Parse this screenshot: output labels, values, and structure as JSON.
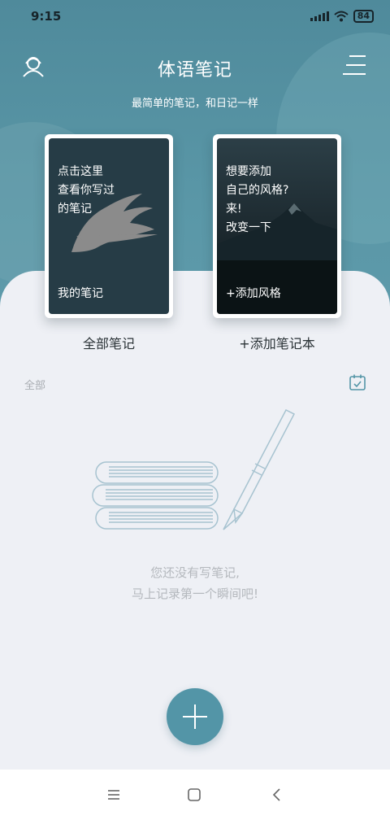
{
  "status_bar": {
    "time": "9:15",
    "battery": "84",
    "icons": [
      "signal-icon",
      "wifi-icon",
      "battery-icon"
    ]
  },
  "header": {
    "title": "体语笔记",
    "subtitle": "最简单的笔记，和日记一样",
    "left_icon": "profile-icon",
    "right_icon": "menu-icon"
  },
  "cards": {
    "my_notes": {
      "lines": [
        "点击这里",
        "查看你写过",
        "的笔记"
      ],
      "footer": "我的笔记",
      "caption": "全部笔记"
    },
    "add_style": {
      "lines": [
        "想要添加",
        "自己的风格?",
        "来!",
        "改变一下"
      ],
      "footer": "+添加风格",
      "caption": "+添加笔记本"
    }
  },
  "list": {
    "filter_label": "全部",
    "calendar_icon": "calendar-icon",
    "empty_line1": "您还没有写笔记,",
    "empty_line2": "马上记录第一个瞬间吧!"
  },
  "fab": {
    "icon": "plus-icon"
  },
  "nav": {
    "icons": [
      "recents-icon",
      "home-icon",
      "back-icon"
    ]
  },
  "colors": {
    "header": "#5a97a7",
    "accent": "#5395a7",
    "card_dark": "#263c46",
    "background": "#eef0f5"
  }
}
